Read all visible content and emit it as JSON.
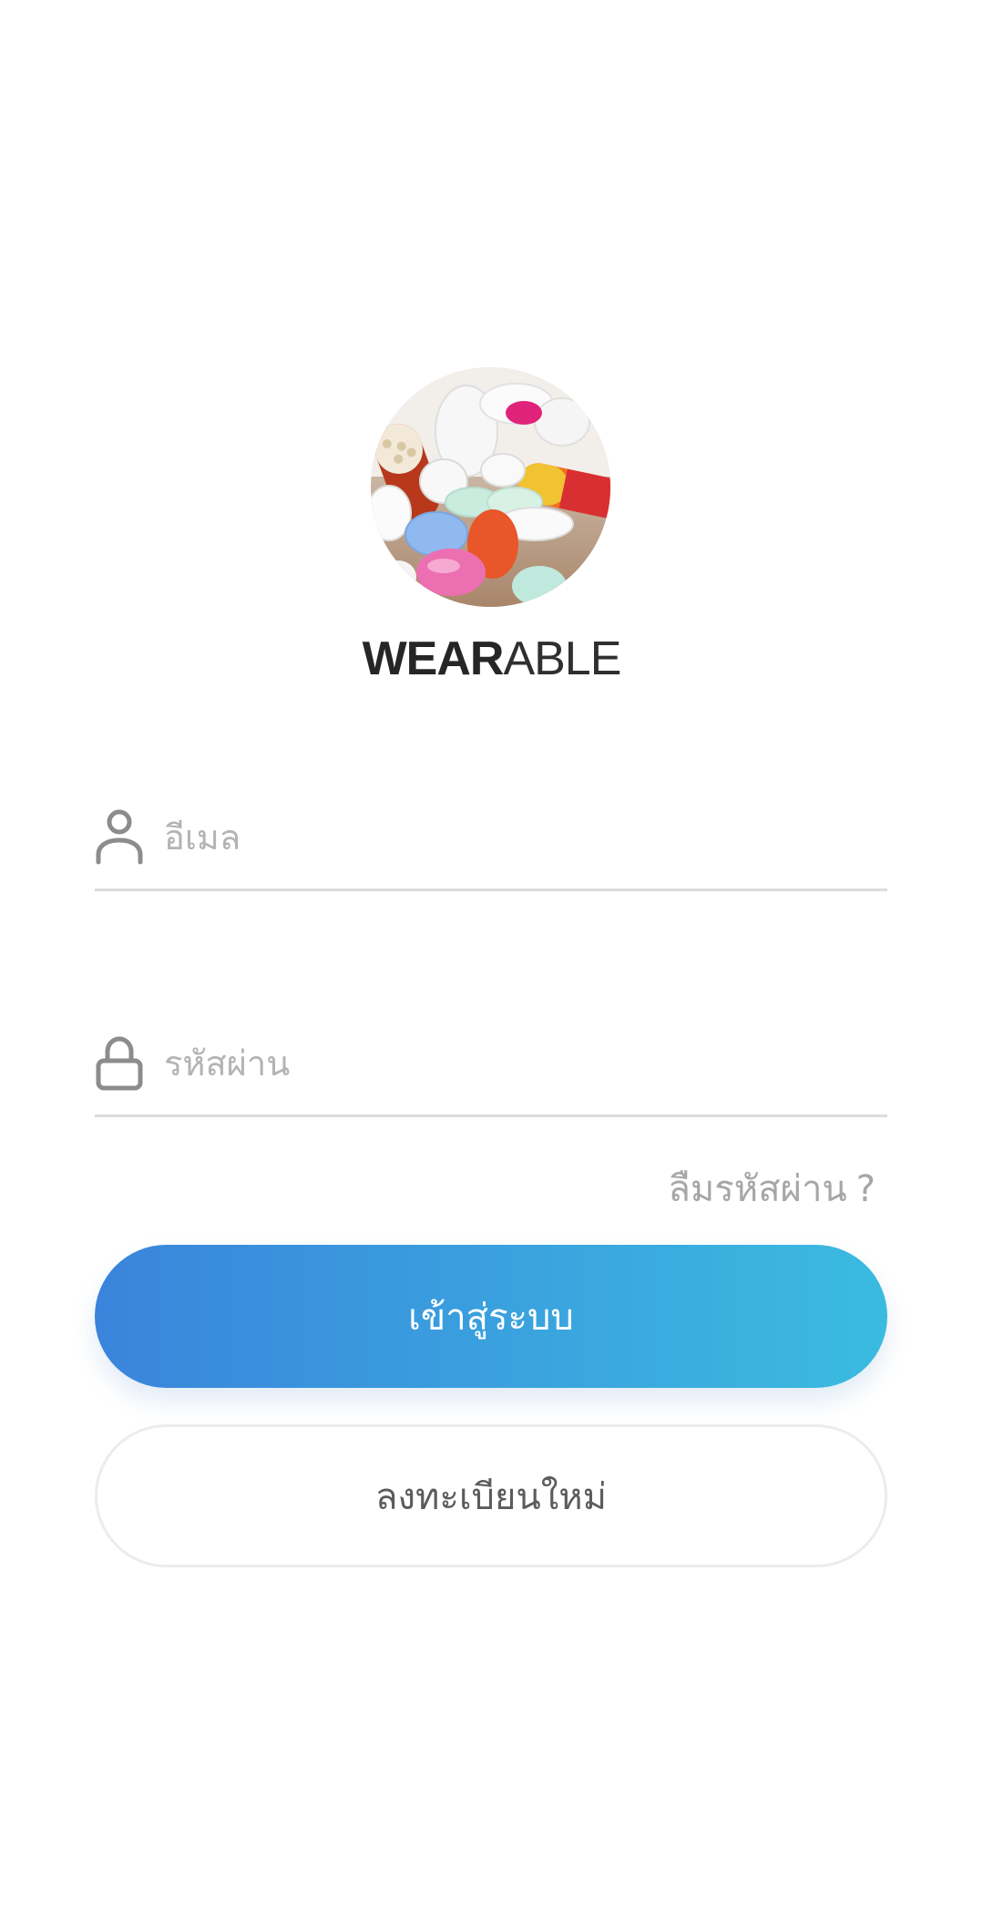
{
  "brand": {
    "bold": "WEAR",
    "light": "ABLE"
  },
  "logo": {
    "description_icon": "pills-photo"
  },
  "form": {
    "email_placeholder": "อีเมล",
    "email_value": "",
    "password_placeholder": "รหัสผ่าน",
    "password_value": "",
    "forgot_label": "ลืมรหัสผ่าน",
    "forgot_question_mark": "?",
    "email_icon": "user-icon",
    "password_icon": "lock-icon"
  },
  "buttons": {
    "login_label": "เข้าสู่ระบบ",
    "register_label": "ลงทะเบียนใหม่"
  },
  "colors": {
    "gradient_start": "#3a84dc",
    "gradient_end": "#3bbbe0",
    "brand_text": "#262626",
    "placeholder": "#b3b3b3",
    "underline": "#dcdcdc"
  }
}
